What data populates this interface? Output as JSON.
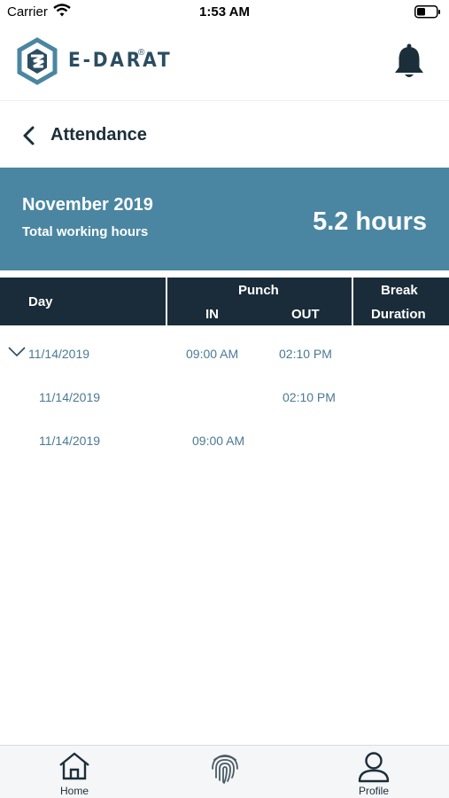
{
  "status_bar": {
    "carrier": "Carrier",
    "time": "1:53 AM"
  },
  "header": {
    "brand": "E-DARAT",
    "registered": "®",
    "icons": [
      "logo-mark",
      "bell-icon"
    ]
  },
  "nav": {
    "title": "Attendance"
  },
  "summary": {
    "month": "November 2019",
    "label": "Total working hours",
    "hours": "5.2 hours",
    "background": "#4a86a1"
  },
  "table": {
    "headers": {
      "day": "Day",
      "punch": "Punch",
      "in": "IN",
      "out": "OUT",
      "break": "Break",
      "duration": "Duration"
    },
    "header_bg": "#1a2c39",
    "rows": [
      {
        "day": "11/14/2019",
        "in": "09:00 AM",
        "out": "02:10 PM",
        "expanded": true
      },
      {
        "day": "11/14/2019",
        "in": "",
        "out": "02:10 PM"
      },
      {
        "day": "11/14/2019",
        "in": "09:00 AM",
        "out": ""
      }
    ]
  },
  "tab_bar": {
    "tabs": [
      {
        "label": "Home",
        "icon": "home-icon"
      },
      {
        "label": "",
        "icon": "fingerprint-icon"
      },
      {
        "label": "Profile",
        "icon": "profile-icon"
      }
    ]
  }
}
